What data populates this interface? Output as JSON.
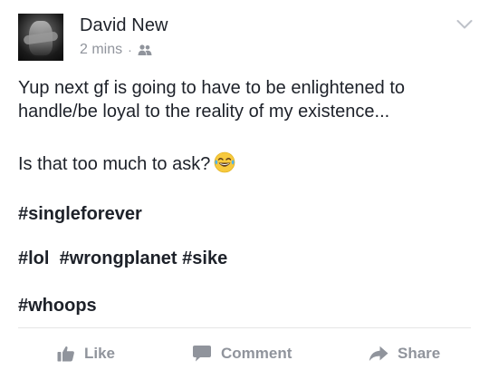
{
  "author": {
    "name": "David New",
    "time": "2 mins",
    "separator": "·",
    "audience_icon": "friends-icon"
  },
  "post": {
    "line1": "Yup next gf is going to have to be enlightened to",
    "line2": "handle/be loyal to the reality of my existence...",
    "question": "Is that too much to ask?",
    "question_emoji": "face-with-tears-of-joy",
    "tag_line1": "#singleforever",
    "tag_line2_a": "#lol",
    "tag_line2_b": "#wrongplanet",
    "tag_line2_c": "#sike",
    "tag_line3": "#whoops"
  },
  "actions": {
    "like_label": "Like",
    "comment_label": "Comment",
    "share_label": "Share"
  },
  "colors": {
    "text": "#1d2129",
    "muted": "#90949c",
    "divider": "#e5e5e5"
  }
}
